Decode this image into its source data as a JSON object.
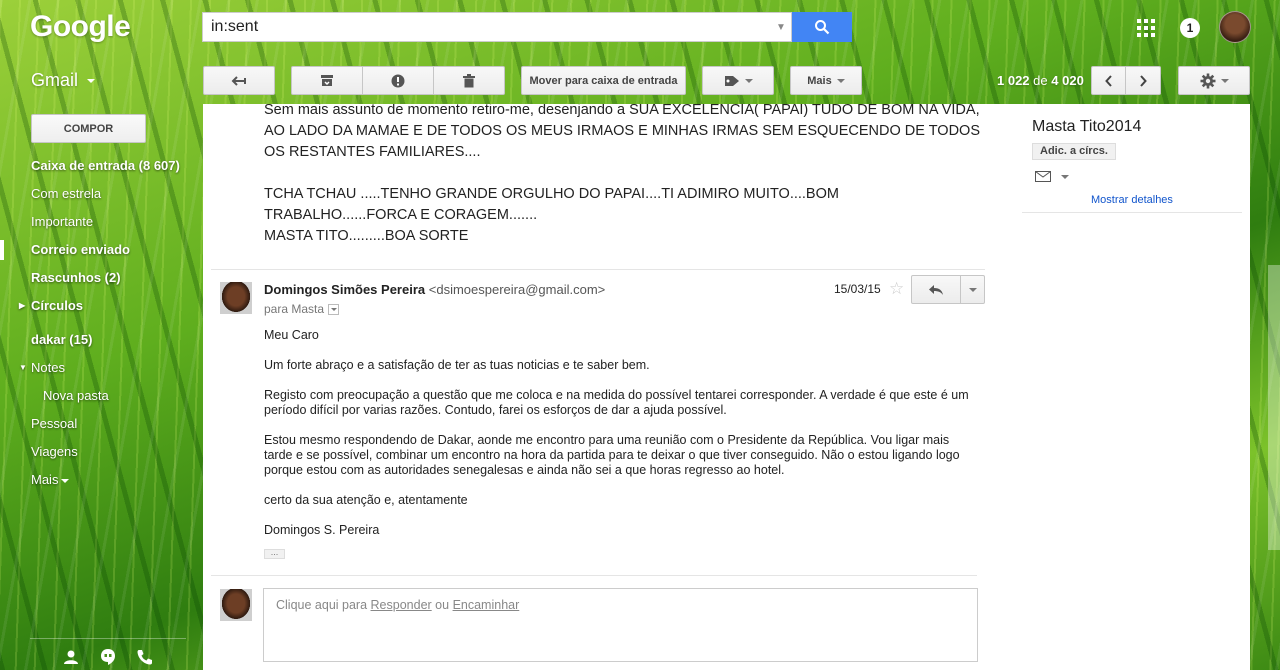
{
  "header": {
    "logo": "Google",
    "search_value": "in:sent",
    "notification_count": "1"
  },
  "toolbar": {
    "app_label": "Gmail",
    "move_to_inbox": "Mover para caixa de entrada",
    "more": "Mais",
    "count_range": "1 022",
    "count_of": "de",
    "count_total": "4 020"
  },
  "sidebar": {
    "compose": "COMPOR",
    "items": [
      {
        "label": "Caixa de entrada (8 607)"
      },
      {
        "label": "Com estrela"
      },
      {
        "label": "Importante"
      },
      {
        "label": "Correio enviado"
      },
      {
        "label": "Rascunhos (2)"
      },
      {
        "label": "Círculos"
      },
      {
        "label": "dakar (15)"
      },
      {
        "label": "Notes"
      },
      {
        "label": "Nova pasta"
      },
      {
        "label": "Pessoal"
      },
      {
        "label": "Viagens"
      },
      {
        "label": "Mais"
      }
    ]
  },
  "previous_message": {
    "text": "Sem mais assunto de momento retiro-me, desenjando a SUA EXCELENCIA( PAPAI) TUDO DE BOM NA VIDA, AO LADO DA MAMAE E DE TODOS OS MEUS IRMAOS E MINHAS IRMAS SEM ESQUECENDO DE TODOS OS RESTANTES FAMILIARES....\n\nTCHA TCHAU .....TENHO GRANDE ORGULHO DO PAPAI....TI ADIMIRO MUITO....BOM TRABALHO......FORCA E CORAGEM.......\nMASTA TITO.........BOA SORTE"
  },
  "message": {
    "sender_name": "Domingos Simões Pereira",
    "sender_email": "<dsimoespereira@gmail.com>",
    "to": "para Masta",
    "date": "15/03/15",
    "paragraphs": [
      "Meu Caro",
      "Um forte abraço e a satisfação de ter as tuas noticias e te saber bem.",
      "Registo com preocupação a questão que me coloca e na medida do possível tentarei corresponder. A verdade é que este é um período difícil por varias razões. Contudo, farei os esforços de dar a ajuda possível.",
      "Estou mesmo respondendo de Dakar, aonde me encontro para uma reunião com o Presidente da República. Vou ligar mais tarde e se possível, combinar um encontro na hora da partida para te deixar o que tiver conseguido. Não o estou ligando logo porque estou com as autoridades senegalesas e ainda não sei a que horas regresso ao hotel.",
      "certo da sua atenção e, atentamente",
      "Domingos S. Pereira"
    ]
  },
  "reply_box": {
    "prefix": "Clique aqui para",
    "reply": "Responder",
    "or": "ou",
    "forward": "Encaminhar"
  },
  "contact_panel": {
    "name": "Masta Tito2014",
    "add_to_circles": "Adic. a círcs.",
    "show_details": "Mostrar detalhes"
  }
}
